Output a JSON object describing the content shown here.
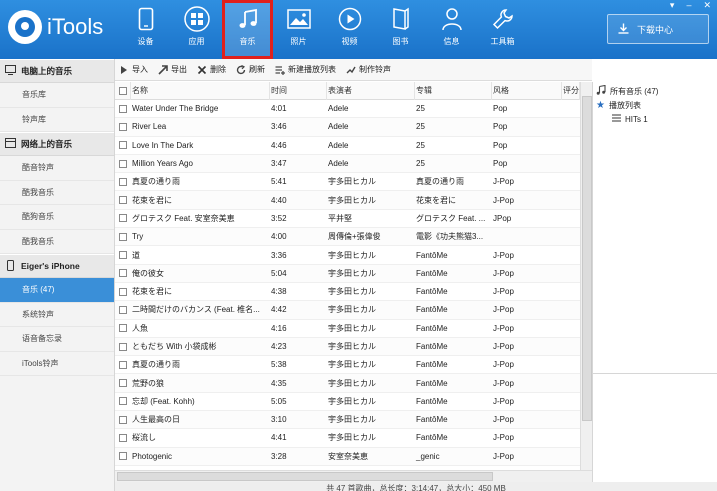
{
  "app": {
    "name": "iTools"
  },
  "nav": [
    {
      "key": "device",
      "label": "设备"
    },
    {
      "key": "apps",
      "label": "应用"
    },
    {
      "key": "music",
      "label": "音乐",
      "selected": true
    },
    {
      "key": "photos",
      "label": "照片"
    },
    {
      "key": "video",
      "label": "视频"
    },
    {
      "key": "books",
      "label": "图书"
    },
    {
      "key": "info",
      "label": "信息"
    },
    {
      "key": "toolbox",
      "label": "工具箱"
    }
  ],
  "download_center": "下载中心",
  "sidebar": {
    "pc_header": "电脑上的音乐",
    "pc_items": [
      "音乐库",
      "铃声库"
    ],
    "online_header": "网络上的音乐",
    "online_items": [
      "酷音铃声",
      "酷我音乐",
      "酷狗音乐",
      "酷我音乐"
    ],
    "device_header": "Eiger's iPhone",
    "device_items": [
      "音乐 (47)",
      "系统铃声",
      "语音备忘录",
      "iTools铃声"
    ]
  },
  "toolbar": {
    "import": "导入",
    "export": "导出",
    "delete": "删除",
    "refresh": "刷新",
    "new_playlist": "新建播放列表",
    "make_ringtone": "制作铃声"
  },
  "columns": {
    "name": "名称",
    "time": "时间",
    "artist": "表演者",
    "album": "专辑",
    "genre": "风格",
    "rating": "评分"
  },
  "songs": [
    {
      "name": "Water Under The Bridge",
      "time": "4:01",
      "artist": "Adele",
      "album": "25",
      "genre": "Pop"
    },
    {
      "name": "River Lea",
      "time": "3:46",
      "artist": "Adele",
      "album": "25",
      "genre": "Pop"
    },
    {
      "name": "Love In The Dark",
      "time": "4:46",
      "artist": "Adele",
      "album": "25",
      "genre": "Pop"
    },
    {
      "name": "Million Years Ago",
      "time": "3:47",
      "artist": "Adele",
      "album": "25",
      "genre": "Pop"
    },
    {
      "name": "真夏の通り雨",
      "time": "5:41",
      "artist": "宇多田ヒカル",
      "album": "真夏の通り雨",
      "genre": "J-Pop"
    },
    {
      "name": "花束を君に",
      "time": "4:40",
      "artist": "宇多田ヒカル",
      "album": "花束を君に",
      "genre": "J-Pop"
    },
    {
      "name": "グロテスク Feat. 安室奈美恵",
      "time": "3:52",
      "artist": "平井堅",
      "album": "グロテスク Feat. ...",
      "genre": "JPop"
    },
    {
      "name": "Try",
      "time": "4:00",
      "artist": "周傳倫+張偉俊",
      "album": "電影《功夫熊猫3...",
      "genre": ""
    },
    {
      "name": "道",
      "time": "3:36",
      "artist": "宇多田ヒカル",
      "album": "FantôMe",
      "genre": "J-Pop"
    },
    {
      "name": "俺の彼女",
      "time": "5:04",
      "artist": "宇多田ヒカル",
      "album": "FantôMe",
      "genre": "J-Pop"
    },
    {
      "name": "花束を君に",
      "time": "4:38",
      "artist": "宇多田ヒカル",
      "album": "FantôMe",
      "genre": "J-Pop"
    },
    {
      "name": "二時間だけのバカンス (Feat. 椎名...",
      "time": "4:42",
      "artist": "宇多田ヒカル",
      "album": "FantôMe",
      "genre": "J-Pop"
    },
    {
      "name": "人魚",
      "time": "4:16",
      "artist": "宇多田ヒカル",
      "album": "FantôMe",
      "genre": "J-Pop"
    },
    {
      "name": "ともだち With 小袋成彬",
      "time": "4:23",
      "artist": "宇多田ヒカル",
      "album": "FantôMe",
      "genre": "J-Pop"
    },
    {
      "name": "真夏の通り雨",
      "time": "5:38",
      "artist": "宇多田ヒカル",
      "album": "FantôMe",
      "genre": "J-Pop"
    },
    {
      "name": "荒野の狼",
      "time": "4:35",
      "artist": "宇多田ヒカル",
      "album": "FantôMe",
      "genre": "J-Pop"
    },
    {
      "name": "忘却 (Feat. Kohh)",
      "time": "5:05",
      "artist": "宇多田ヒカル",
      "album": "FantôMe",
      "genre": "J-Pop"
    },
    {
      "name": "人生最高の日",
      "time": "3:10",
      "artist": "宇多田ヒカル",
      "album": "FantôMe",
      "genre": "J-Pop"
    },
    {
      "name": "桜流し",
      "time": "4:41",
      "artist": "宇多田ヒカル",
      "album": "FantôMe",
      "genre": "J-Pop"
    },
    {
      "name": "Photogenic",
      "time": "3:28",
      "artist": "安室奈美恵",
      "album": "_genic",
      "genre": "J-Pop"
    }
  ],
  "right_panel": {
    "all_music": "所有音乐 (47)",
    "playlists": "播放列表",
    "playlist_items": [
      "HITs 1"
    ]
  },
  "status": "共 47 首歌曲，总长度：3:14:47，总大小：450 MB"
}
